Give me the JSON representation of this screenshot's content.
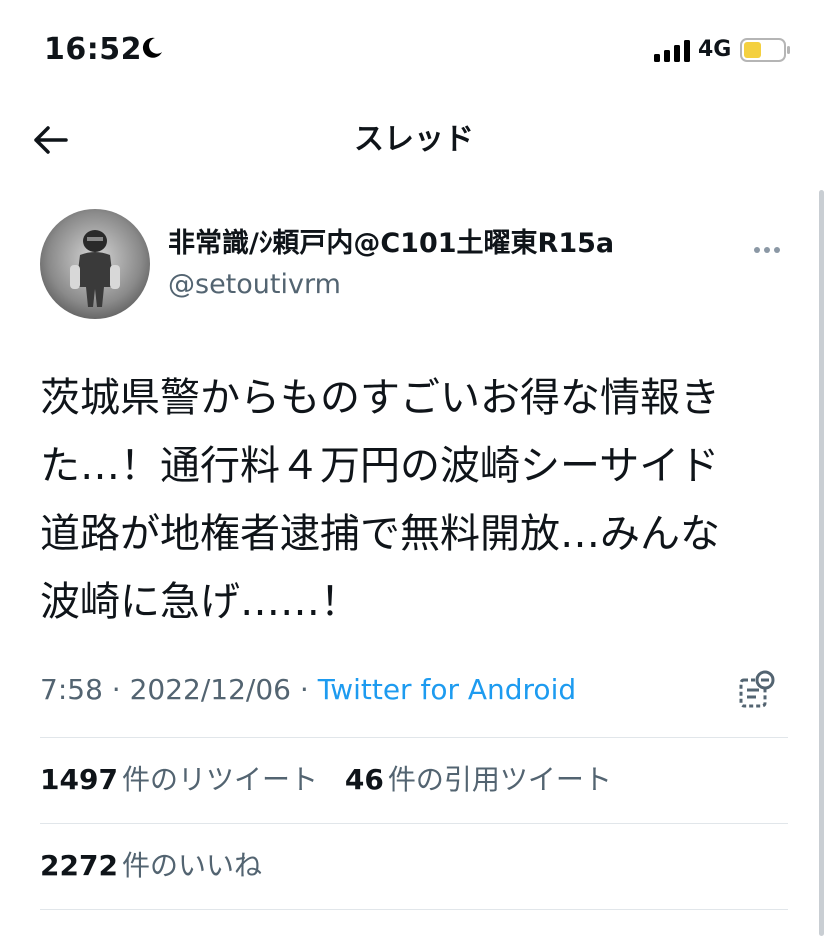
{
  "status_bar": {
    "time": "16:52",
    "network": "4G",
    "icons": [
      "moon-icon",
      "signal-icon",
      "battery-icon"
    ]
  },
  "header": {
    "title": "スレッド",
    "back_icon": "arrow-left-icon"
  },
  "tweet": {
    "author": {
      "display_name": "非常識/ｼ頼戸内@C101土曜東R15a",
      "handle": "@setoutivrm"
    },
    "text_lines": [
      "茨城県警からものすごいお得な情報き",
      "た…！通行料４万円の波崎シーサイド",
      "道路が地権者逮捕で無料開放…みんな",
      "波崎に急げ……！"
    ],
    "time": "7:58",
    "date": "2022/12/06",
    "separator": "·",
    "source": "Twitter for Android"
  },
  "stats": {
    "retweets_count": "1497",
    "retweets_label": "件のリツイート",
    "quotes_count": "46",
    "quotes_label": "件の引用ツイート",
    "likes_count": "2272",
    "likes_label": "件のいいね"
  },
  "colors": {
    "text": "#0f1419",
    "secondary": "#536471",
    "link": "#1d9bf0",
    "divider": "#e1e6ea",
    "battery_fill": "#f4d03f"
  }
}
